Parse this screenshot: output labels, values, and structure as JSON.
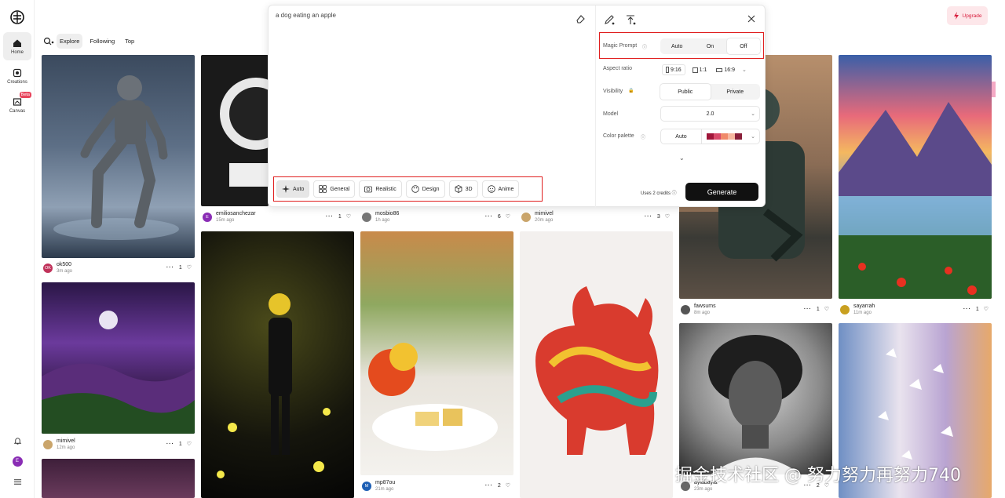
{
  "sidebar": {
    "items": [
      {
        "label": "Home",
        "icon": "home-icon"
      },
      {
        "label": "Creations",
        "icon": "creations-icon"
      },
      {
        "label": "Canvas",
        "icon": "canvas-icon",
        "badge": "Beta"
      }
    ],
    "avatar_initial": "E"
  },
  "header": {
    "tabs": [
      "Explore",
      "Following",
      "Top"
    ],
    "upgrade_label": "Upgrade"
  },
  "panel": {
    "prompt": "a dog eating an apple",
    "styles": [
      "Auto",
      "General",
      "Realistic",
      "Design",
      "3D",
      "Anime"
    ],
    "magic_prompt": {
      "label": "Magic Prompt",
      "options": [
        "Auto",
        "On",
        "Off"
      ],
      "selected": "Off"
    },
    "aspect_ratio": {
      "label": "Aspect ratio",
      "options": [
        "9:16",
        "1:1",
        "16:9"
      ]
    },
    "visibility": {
      "label": "Visibility",
      "options": [
        "Public",
        "Private"
      ],
      "selected": "Public"
    },
    "model": {
      "label": "Model",
      "value": "2.0"
    },
    "color_palette": {
      "label": "Color palette",
      "value": "Auto"
    },
    "credits": "Uses 2 credits",
    "generate_label": "Generate"
  },
  "feed": [
    {
      "user": "ok500",
      "ago": "3m ago",
      "likes": "1",
      "initial": "OK",
      "color": "#c0325a"
    },
    {
      "user": "mimivel",
      "ago": "12m ago",
      "likes": "1",
      "initial": "",
      "color": "#caa56b"
    },
    {
      "user": "emiliosanchezar",
      "ago": "15m ago",
      "likes": "1",
      "initial": "E",
      "color": "#8a2db5"
    },
    {
      "user": "mosbio86",
      "ago": "1h ago",
      "likes": "6",
      "initial": "",
      "color": "#777"
    },
    {
      "user": "mp87ou",
      "ago": "21m ago",
      "likes": "2",
      "initial": "M",
      "color": "#1d5fb4"
    },
    {
      "user": "mimivel",
      "ago": "20m ago",
      "likes": "3",
      "initial": "",
      "color": "#caa56b"
    },
    {
      "user": "fawsums",
      "ago": "8m ago",
      "likes": "1",
      "initial": "",
      "color": "#555"
    },
    {
      "user": "aylabayla",
      "ago": "23m ago",
      "likes": "2",
      "initial": "",
      "color": "#666"
    },
    {
      "user": "sayarrah",
      "ago": "11m ago",
      "likes": "1",
      "initial": "",
      "color": "#c9a020"
    }
  ],
  "watermark": "掘金技术社区 @ 努力努力再努力740"
}
